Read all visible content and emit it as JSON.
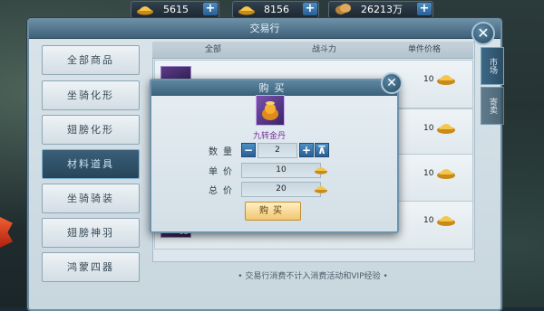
{
  "currency": [
    {
      "icon": "gold-ingot-icon",
      "value": "5615"
    },
    {
      "icon": "gold-ingot-icon",
      "value": "8156"
    },
    {
      "icon": "copper-coins-icon",
      "value": "26213万"
    }
  ],
  "panel": {
    "title": "交易行",
    "categories": [
      "全部商品",
      "坐骑化形",
      "翅膀化形",
      "材料道具",
      "坐骑骑装",
      "翅膀神羽",
      "鸿蒙四器"
    ],
    "active_category": "材料道具",
    "right_tabs": [
      "市场",
      "寄卖"
    ],
    "columns": {
      "filter": "全部",
      "power": "战斗力",
      "price": "单件价格"
    },
    "rows": [
      {
        "price": "10"
      },
      {
        "price": "10"
      },
      {
        "price": "10"
      },
      {
        "price": "10",
        "qty": "52"
      }
    ],
    "footer": "• 交易行消费不计入消费活动和VIP经验 •"
  },
  "modal": {
    "title": "购买",
    "item_name": "九转金丹",
    "quantity_label": "数量",
    "quantity": "2",
    "unit_price_label": "单价",
    "unit_price": "10",
    "total_label": "总价",
    "total": "20",
    "buy_label": "购买",
    "minus": "−",
    "plus": "+",
    "max": "⊼"
  },
  "colors": {
    "accent": "#3b617b",
    "gold": "#f1c671",
    "item_purple": "#7a2f9a"
  }
}
